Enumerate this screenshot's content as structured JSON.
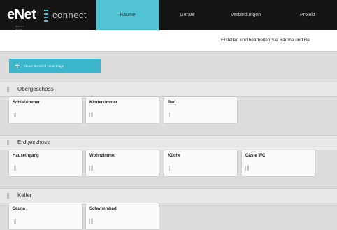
{
  "header": {
    "logo_main": "eNet",
    "logo_tag": "SMART HOME",
    "logo_product": "connect",
    "tabs": [
      {
        "label": "Räume",
        "active": true
      },
      {
        "label": "Geräte",
        "active": false
      },
      {
        "label": "Verbindungen",
        "active": false
      },
      {
        "label": "Projekt",
        "active": false
      }
    ],
    "accent_color": "#52c3d3"
  },
  "subtitle": "Erstellen und bearbeiten Sie Räume und Be",
  "add_button": {
    "icon": "plus-icon",
    "label": "Neuer Bereich / Neue Etage"
  },
  "sections": [
    {
      "title": "Obergeschoss",
      "rooms": [
        "Schlafzimmer",
        "Kinderzimmer",
        "Bad"
      ]
    },
    {
      "title": "Erdgeschoss",
      "rooms": [
        "Hauseingang",
        "Wohnzimmer",
        "Küche",
        "Gäste WC"
      ]
    },
    {
      "title": "Keller",
      "rooms": [
        "Sauna",
        "Schwimmbad"
      ]
    }
  ]
}
